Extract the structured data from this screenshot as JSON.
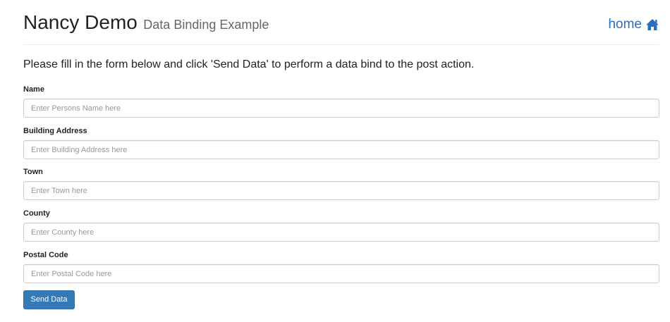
{
  "header": {
    "title": "Nancy Demo",
    "subtitle": "Data Binding Example",
    "home_label": "home",
    "home_icon": "home-icon"
  },
  "intro": "Please fill in the form below and click 'Send Data' to perform a data bind to the post action.",
  "form": {
    "fields": [
      {
        "label": "Name",
        "placeholder": "Enter Persons Name here",
        "value": ""
      },
      {
        "label": "Building Address",
        "placeholder": "Enter Building Address here",
        "value": ""
      },
      {
        "label": "Town",
        "placeholder": "Enter Town here",
        "value": ""
      },
      {
        "label": "County",
        "placeholder": "Enter County here",
        "value": ""
      },
      {
        "label": "Postal Code",
        "placeholder": "Enter Postal Code here",
        "value": ""
      }
    ],
    "submit_label": "Send Data"
  },
  "colors": {
    "accent": "#337ab7",
    "link": "#2a6ebb"
  }
}
